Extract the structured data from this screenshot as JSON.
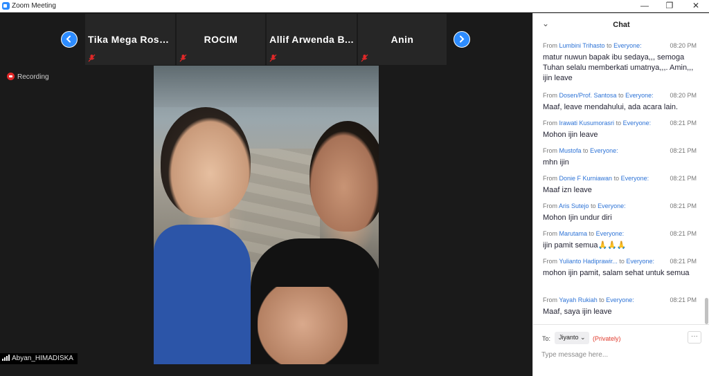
{
  "window": {
    "title": "Zoom Meeting",
    "controls": [
      "—",
      "❐",
      "✕"
    ]
  },
  "meeting": {
    "participants": [
      {
        "name": "Tika Mega Rosti..."
      },
      {
        "name": "ROCIM"
      },
      {
        "name": "Allif Arwenda B..."
      },
      {
        "name": "Anin"
      }
    ],
    "recording_label": "Recording",
    "self_name": "Abyan_HIMADISKA"
  },
  "chat": {
    "title": "Chat",
    "collapse_glyph": "⌄",
    "from_label": "From",
    "to_label": "to",
    "messages": [
      {
        "sender": "Lumbini Trihasto",
        "recipient": "Everyone:",
        "time": "08:20 PM",
        "text": "matur nuwun bapak ibu sedaya,,, semoga Tuhan selalu memberkati umatnya,,,. Amin,,, ijin leave"
      },
      {
        "sender": "Dosen/Prof. Santosa",
        "recipient": "Everyone:",
        "time": "08:20 PM",
        "text": "Maaf, leave mendahului, ada acara lain."
      },
      {
        "sender": "Irawati Kusumorasri",
        "recipient": "Everyone:",
        "time": "08:21 PM",
        "text": "Mohon ijin leave"
      },
      {
        "sender": "Mustofa",
        "recipient": "Everyone:",
        "time": "08:21 PM",
        "text": "mhn ijin"
      },
      {
        "sender": "Donie F Kurniawan",
        "recipient": "Everyone:",
        "time": "08:21 PM",
        "text": "Maaf  izn leave"
      },
      {
        "sender": "Aris Sutejo",
        "recipient": "Everyone:",
        "time": "08:21 PM",
        "text": "Mohon Ijin undur diri"
      },
      {
        "sender": "Marutama",
        "recipient": "Everyone:",
        "time": "08:21 PM",
        "text": "ijin pamit semua🙏🙏🙏"
      },
      {
        "sender": "Yulianto Hadiprawir...",
        "recipient": "Everyone:",
        "time": "08:21 PM",
        "text": "mohon ijin pamit, salam sehat untuk semua"
      },
      {
        "sender": "Yayah Rukiah",
        "recipient": "Everyone:",
        "time": "08:21 PM",
        "text": "Maaf, saya ijin leave"
      }
    ],
    "composer": {
      "to_label": "To:",
      "recipient": "Jiyanto ⌄",
      "privacy": "(Privately)",
      "more_label": "···",
      "placeholder": "Type message here..."
    }
  },
  "colors": {
    "accent": "#2d8cff",
    "recording": "#e02828",
    "privately": "#e0392b",
    "link": "#2d73d6"
  }
}
